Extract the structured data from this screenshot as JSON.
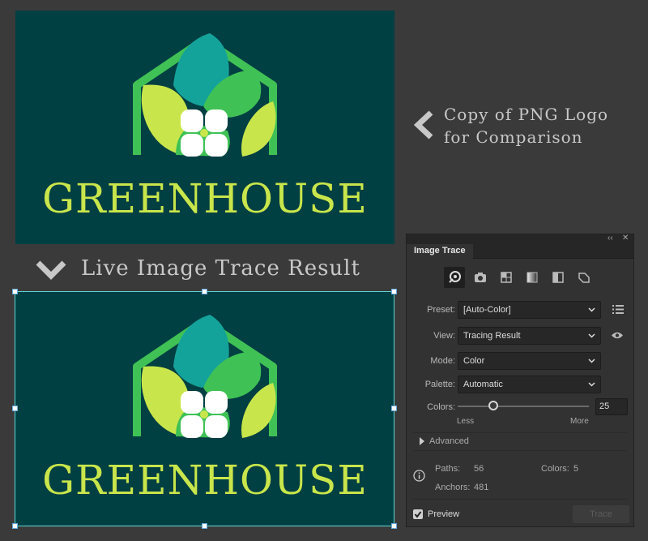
{
  "logo": {
    "wordmark": "GREENHOUSE",
    "colors": {
      "background": "#003f42",
      "teal": "#14a39a",
      "green": "#3fc155",
      "lime": "#c8e64b",
      "white": "#ffffff"
    }
  },
  "annotations": {
    "comparison_line1": "Copy of PNG Logo",
    "comparison_line2": "for Comparison",
    "trace_result": "Live Image Trace Result"
  },
  "panel": {
    "title": "Image Trace",
    "preset": {
      "label": "Preset:",
      "value": "[Auto-Color]"
    },
    "view": {
      "label": "View:",
      "value": "Tracing Result"
    },
    "mode": {
      "label": "Mode:",
      "value": "Color"
    },
    "palette": {
      "label": "Palette:",
      "value": "Automatic"
    },
    "colors": {
      "label": "Colors:",
      "value": "25",
      "slider_fraction": 0.27,
      "less": "Less",
      "more": "More"
    },
    "advanced": "Advanced",
    "stats": {
      "paths_label": "Paths:",
      "paths_value": "56",
      "colors_label": "Colors:",
      "colors_value": "5",
      "anchors_label": "Anchors:",
      "anchors_value": "481"
    },
    "preview": "Preview",
    "trace_button": "Trace"
  }
}
